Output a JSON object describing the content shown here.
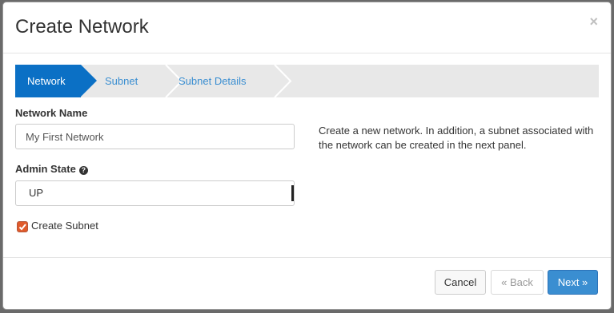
{
  "modal": {
    "title": "Create Network",
    "close_glyph": "×"
  },
  "wizard": {
    "steps": [
      {
        "label": "Network",
        "active": true
      },
      {
        "label": "Subnet",
        "active": false
      },
      {
        "label": "Subnet Details",
        "active": false
      }
    ]
  },
  "form": {
    "network_name_label": "Network Name",
    "network_name_value": "My First Network",
    "admin_state_label": "Admin State",
    "admin_state_help_icon": "question-circle-icon",
    "admin_state_value": "UP",
    "create_subnet_label": "Create Subnet",
    "create_subnet_checked": true
  },
  "help": {
    "text": "Create a new network. In addition, a subnet associated with the network can be created in the next panel."
  },
  "footer": {
    "cancel_label": "Cancel",
    "back_label": "« Back",
    "next_label": "Next »"
  },
  "colors": {
    "active_step": "#0b70c5",
    "link": "#3a8ed1",
    "primary_button": "#3a8ed1",
    "checkbox": "#e05a2b"
  }
}
